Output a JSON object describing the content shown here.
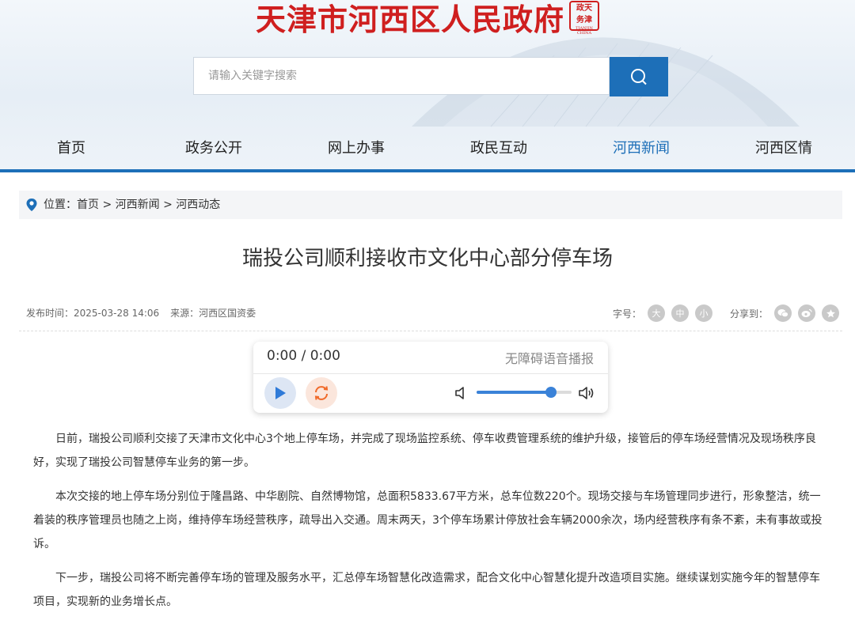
{
  "site": {
    "name": "天津市河西区人民政府",
    "seal_top": "政天",
    "seal_mid": "务津",
    "seal_sub": "TIANJIN CHINA"
  },
  "search": {
    "placeholder": "请输入关键字搜索",
    "button_icon": "search-icon"
  },
  "nav": [
    "首页",
    "政务公开",
    "网上办事",
    "政民互动",
    "河西新闻",
    "河西区情"
  ],
  "nav_active": 4,
  "breadcrumb": {
    "prefix": "位置：",
    "items": [
      "首页",
      "河西新闻",
      "河西动态"
    ],
    "sep": " > "
  },
  "article": {
    "title": "瑞投公司顺利接收市文化中心部分停车场",
    "publish_label": "发布时间：",
    "publish_time": "2025-03-28 14:06",
    "source_label": "来源：",
    "source": "河西区国资委",
    "font_size_label": "字号：",
    "font_sizes": [
      "大",
      "中",
      "小"
    ],
    "share_label": "分享到：",
    "share_icons": [
      "wechat-icon",
      "weibo-icon",
      "favorite-icon"
    ],
    "paragraphs": [
      "日前，瑞投公司顺利交接了天津市文化中心3个地上停车场，并完成了现场监控系统、停车收费管理系统的维护升级，接管后的停车场经营情况及现场秩序良好，实现了瑞投公司智慧停车业务的第一步。",
      "本次交接的地上停车场分别位于隆昌路、中华剧院、自然博物馆，总面积5833.67平方米，总车位数220个。现场交接与车场管理同步进行，形象整洁，统一着装的秩序管理员也随之上岗，维持停车场经营秩序，疏导出入交通。周末两天，3个停车场累计停放社会车辆2000余次，场内经营秩序有条不紊，未有事故或投诉。",
      "下一步，瑞投公司将不断完善停车场的管理及服务水平，汇总停车场智慧化改造需求，配合文化中心智慧化提升改造项目实施。继续谋划实施今年的智慧停车项目，实现新的业务增长点。"
    ]
  },
  "player": {
    "time": "0:00 / 0:00",
    "label": "无障碍语音播报",
    "volume": 0.78,
    "accent": "#3a82d8"
  },
  "colors": {
    "brand_red": "#cf1f1f",
    "brand_blue": "#1d6fb8"
  }
}
